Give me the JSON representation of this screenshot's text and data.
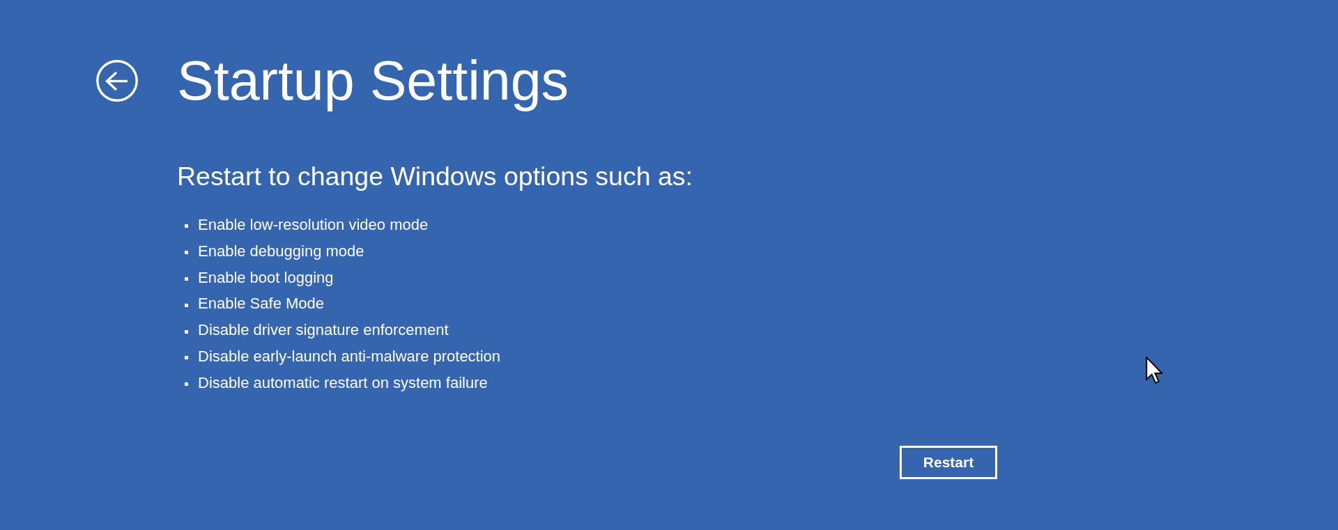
{
  "header": {
    "title": "Startup Settings"
  },
  "intro": "Restart to change Windows options such as:",
  "options": [
    "Enable low-resolution video mode",
    "Enable debugging mode",
    "Enable boot logging",
    "Enable Safe Mode",
    "Disable driver signature enforcement",
    "Disable early-launch anti-malware protection",
    "Disable automatic restart on system failure"
  ],
  "button": {
    "label": "Restart"
  }
}
